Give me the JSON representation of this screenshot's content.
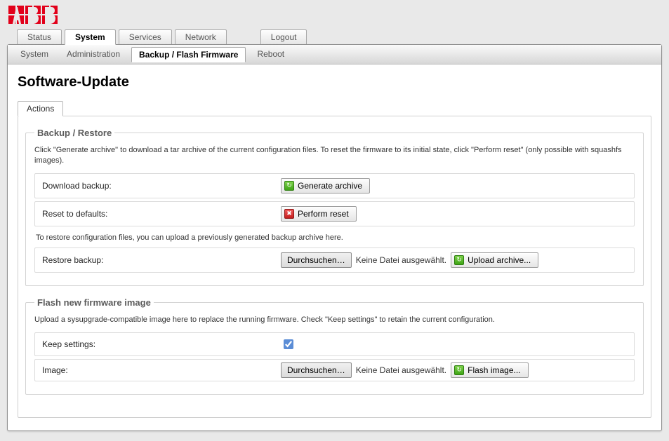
{
  "logo_text": "ABB",
  "top_tabs": {
    "status": "Status",
    "system": "System",
    "services": "Services",
    "network": "Network",
    "logout": "Logout"
  },
  "sub_nav": {
    "system": "System",
    "administration": "Administration",
    "backup": "Backup / Flash Firmware",
    "reboot": "Reboot"
  },
  "page_title": "Software-Update",
  "inner_tab_label": "Actions",
  "backup": {
    "legend": "Backup / Restore",
    "help": "Click \"Generate archive\" to download a tar archive of the current configuration files. To reset the firmware to its initial state, click \"Perform reset\" (only possible with squashfs images).",
    "download_label": "Download backup:",
    "generate_btn": "Generate archive",
    "reset_label": "Reset to defaults:",
    "reset_btn": "Perform reset",
    "restore_note": "To restore configuration files, you can upload a previously generated backup archive here.",
    "restore_label": "Restore backup:",
    "browse_btn": "Durchsuchen…",
    "no_file": "Keine Datei ausgewählt.",
    "upload_btn": "Upload archive..."
  },
  "flash": {
    "legend": "Flash new firmware image",
    "help": "Upload a sysupgrade-compatible image here to replace the running firmware. Check \"Keep settings\" to retain the current configuration.",
    "keep_label": "Keep settings:",
    "image_label": "Image:",
    "browse_btn": "Durchsuchen…",
    "no_file": "Keine Datei ausgewählt.",
    "flash_btn": "Flash image..."
  }
}
